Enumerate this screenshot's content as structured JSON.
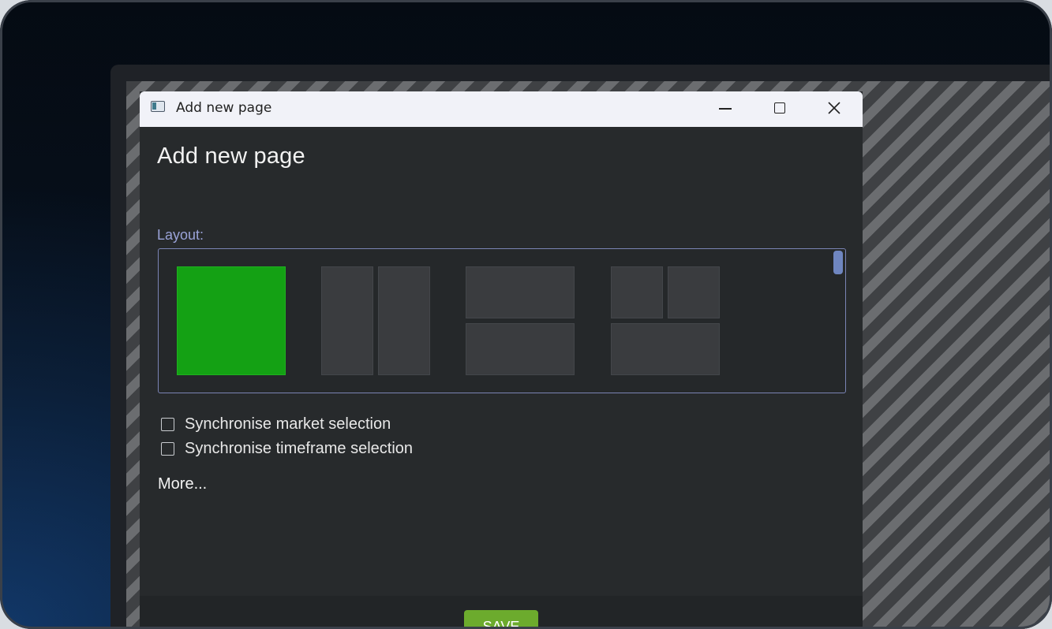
{
  "window": {
    "title": "Add new page",
    "controls": {
      "minimize_icon": "minimize-icon",
      "maximize_icon": "maximize-icon",
      "close_icon": "close-icon"
    }
  },
  "dialog": {
    "heading": "Add new page",
    "layout_label": "Layout:",
    "layout_options": [
      {
        "name": "single",
        "selected": true
      },
      {
        "name": "two-columns",
        "selected": false
      },
      {
        "name": "two-rows",
        "selected": false
      },
      {
        "name": "two-top-one-bottom",
        "selected": false
      }
    ],
    "checkboxes": [
      {
        "label": "Synchronise market selection",
        "checked": false
      },
      {
        "label": "Synchronise timeframe selection",
        "checked": false
      }
    ],
    "more_link": "More...",
    "save_label": "SAVE"
  },
  "colors": {
    "selected_layout": "#14a114",
    "save_button": "#6cab2d",
    "layout_label": "#9aa3d8",
    "dialog_background": "#272a2c"
  }
}
